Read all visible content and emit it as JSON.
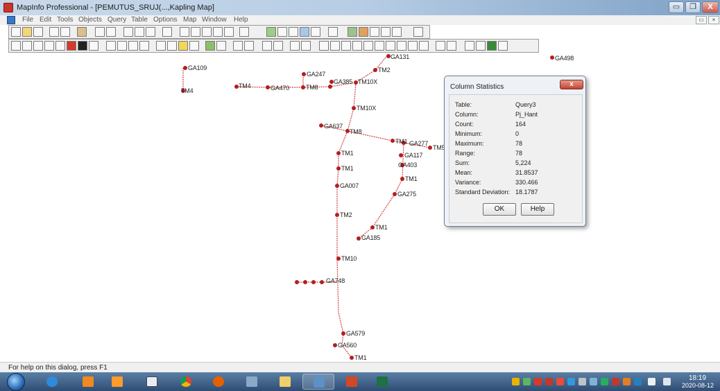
{
  "window": {
    "title": "MapInfo Professional - [PEMUTUS_SRUJ(...,Kapling Map]",
    "min_glyph": "▭",
    "max_glyph": "❐",
    "close_glyph": "X",
    "mdi_restore_glyph": "▭",
    "mdi_close_glyph": "×"
  },
  "menu": [
    "File",
    "Edit",
    "Tools",
    "Objects",
    "Query",
    "Table",
    "Options",
    "Map",
    "Window",
    "Help"
  ],
  "map_labels": [
    {
      "text": "GA131"
    },
    {
      "text": "GA498"
    },
    {
      "text": "GA109"
    },
    {
      "text": "TM2"
    },
    {
      "text": "GA247"
    },
    {
      "text": "TM4"
    },
    {
      "text": "TM4"
    },
    {
      "text": "GA385"
    },
    {
      "text": "TM10X"
    },
    {
      "text": "GA470"
    },
    {
      "text": "TM8"
    },
    {
      "text": "TM10X"
    },
    {
      "text": "GA637"
    },
    {
      "text": "TM8"
    },
    {
      "text": "TM1"
    },
    {
      "text": "GA277"
    },
    {
      "text": "TM5"
    },
    {
      "text": "TM1"
    },
    {
      "text": "GA117"
    },
    {
      "text": "TM1"
    },
    {
      "text": "GA403"
    },
    {
      "text": "TM1"
    },
    {
      "text": "GA007"
    },
    {
      "text": "GA275"
    },
    {
      "text": "TM2"
    },
    {
      "text": "TM1"
    },
    {
      "text": "GA185"
    },
    {
      "text": "TM10"
    },
    {
      "text": "GA748"
    },
    {
      "text": "GA579"
    },
    {
      "text": "GA560"
    },
    {
      "text": "TM1"
    }
  ],
  "dialog": {
    "title": "Column Statistics",
    "close_glyph": "x",
    "rows": [
      {
        "label": "Table:",
        "value": "Query3"
      },
      {
        "label": "Column:",
        "value": "Pj_Hant"
      },
      {
        "label": "Count:",
        "value": "164"
      },
      {
        "label": "Minimum:",
        "value": "0"
      },
      {
        "label": "Maximum:",
        "value": "78"
      },
      {
        "label": "Range:",
        "value": "78"
      },
      {
        "label": "Sum:",
        "value": "5,224"
      },
      {
        "label": "Mean:",
        "value": "31.8537"
      },
      {
        "label": "Variance:",
        "value": "330.466"
      },
      {
        "label": "Standard Deviation:",
        "value": "18.1787"
      }
    ],
    "ok_label": "OK",
    "help_label": "Help"
  },
  "status": {
    "text": "For help on this dialog, press F1"
  },
  "clock": {
    "time": "18:19",
    "date": "2020-08-12"
  },
  "colors": {
    "route_line": "#d23c3c",
    "node": "#b21f1f",
    "accent": "#2f4d74"
  }
}
